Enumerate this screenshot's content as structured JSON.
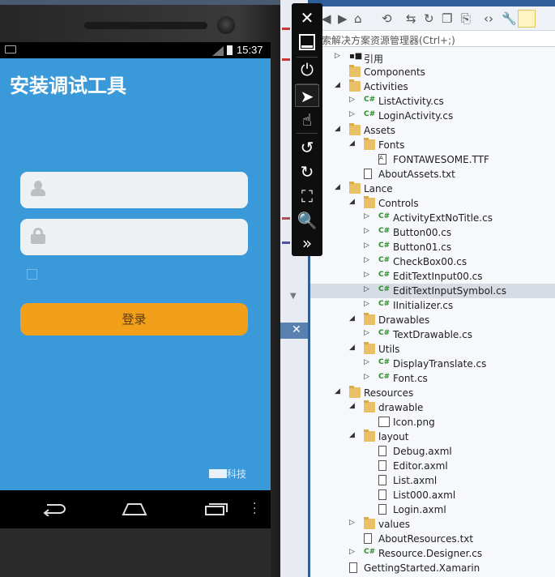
{
  "phone": {
    "time": "15:37",
    "app_title": "安装调试工具",
    "login_label": "登录",
    "brand_text": "科技"
  },
  "explorer": {
    "search_placeholder": "索解决方案资源管理器(Ctrl+;)",
    "items": [
      {
        "label": "引用",
        "indent": 0,
        "arrow": "collapsed",
        "icon": "references-icon"
      },
      {
        "label": "Components",
        "indent": 0,
        "arrow": "none",
        "icon": "folder-icon"
      },
      {
        "label": "Activities",
        "indent": 0,
        "arrow": "expanded",
        "icon": "folder-icon"
      },
      {
        "label": "ListActivity.cs",
        "indent": 1,
        "arrow": "collapsed",
        "icon": "csharp-file-icon"
      },
      {
        "label": "LoginActivity.cs",
        "indent": 1,
        "arrow": "collapsed",
        "icon": "csharp-file-icon"
      },
      {
        "label": "Assets",
        "indent": 0,
        "arrow": "expanded",
        "icon": "folder-icon"
      },
      {
        "label": "Fonts",
        "indent": 1,
        "arrow": "expanded",
        "icon": "folder-icon"
      },
      {
        "label": "FONTAWESOME.TTF",
        "indent": 2,
        "arrow": "none",
        "icon": "font-file-icon"
      },
      {
        "label": "AboutAssets.txt",
        "indent": 1,
        "arrow": "none",
        "icon": "text-file-icon"
      },
      {
        "label": "Lance",
        "indent": 0,
        "arrow": "expanded",
        "icon": "folder-icon"
      },
      {
        "label": "Controls",
        "indent": 1,
        "arrow": "expanded",
        "icon": "folder-icon"
      },
      {
        "label": "ActivityExtNoTitle.cs",
        "indent": 2,
        "arrow": "collapsed",
        "icon": "csharp-file-icon"
      },
      {
        "label": "Button00.cs",
        "indent": 2,
        "arrow": "collapsed",
        "icon": "csharp-file-icon"
      },
      {
        "label": "Button01.cs",
        "indent": 2,
        "arrow": "collapsed",
        "icon": "csharp-file-icon"
      },
      {
        "label": "CheckBox00.cs",
        "indent": 2,
        "arrow": "collapsed",
        "icon": "csharp-file-icon"
      },
      {
        "label": "EditTextInput00.cs",
        "indent": 2,
        "arrow": "collapsed",
        "icon": "csharp-file-icon"
      },
      {
        "label": "EditTextInputSymbol.cs",
        "indent": 2,
        "arrow": "collapsed",
        "icon": "csharp-file-icon",
        "selected": true
      },
      {
        "label": "IInitializer.cs",
        "indent": 2,
        "arrow": "collapsed",
        "icon": "csharp-file-icon"
      },
      {
        "label": "Drawables",
        "indent": 1,
        "arrow": "expanded",
        "icon": "folder-icon"
      },
      {
        "label": "TextDrawable.cs",
        "indent": 2,
        "arrow": "collapsed",
        "icon": "csharp-file-icon"
      },
      {
        "label": "Utils",
        "indent": 1,
        "arrow": "expanded",
        "icon": "folder-icon"
      },
      {
        "label": "DisplayTranslate.cs",
        "indent": 2,
        "arrow": "collapsed",
        "icon": "csharp-file-icon"
      },
      {
        "label": "Font.cs",
        "indent": 2,
        "arrow": "collapsed",
        "icon": "csharp-file-icon"
      },
      {
        "label": "Resources",
        "indent": 0,
        "arrow": "expanded",
        "icon": "folder-icon"
      },
      {
        "label": "drawable",
        "indent": 1,
        "arrow": "expanded",
        "icon": "folder-icon"
      },
      {
        "label": "Icon.png",
        "indent": 2,
        "arrow": "none",
        "icon": "image-file-icon"
      },
      {
        "label": "layout",
        "indent": 1,
        "arrow": "expanded",
        "icon": "folder-icon"
      },
      {
        "label": "Debug.axml",
        "indent": 2,
        "arrow": "none",
        "icon": "axml-file-icon"
      },
      {
        "label": "Editor.axml",
        "indent": 2,
        "arrow": "none",
        "icon": "axml-file-icon"
      },
      {
        "label": "List.axml",
        "indent": 2,
        "arrow": "none",
        "icon": "axml-file-icon"
      },
      {
        "label": "List000.axml",
        "indent": 2,
        "arrow": "none",
        "icon": "axml-file-icon"
      },
      {
        "label": "Login.axml",
        "indent": 2,
        "arrow": "none",
        "icon": "axml-file-icon"
      },
      {
        "label": "values",
        "indent": 1,
        "arrow": "collapsed",
        "icon": "folder-icon"
      },
      {
        "label": "AboutResources.txt",
        "indent": 1,
        "arrow": "none",
        "icon": "text-file-icon"
      },
      {
        "label": "Resource.Designer.cs",
        "indent": 1,
        "arrow": "collapsed",
        "icon": "csharp-file-icon"
      },
      {
        "label": "GettingStarted.Xamarin",
        "indent": 0,
        "arrow": "none",
        "icon": "text-file-icon"
      }
    ]
  },
  "colors": {
    "screen_bg": "#3a9ad9",
    "login_button": "#f2a01c",
    "selected_row": "#d6dbe4",
    "csharp_badge": "#2e8b2e"
  }
}
